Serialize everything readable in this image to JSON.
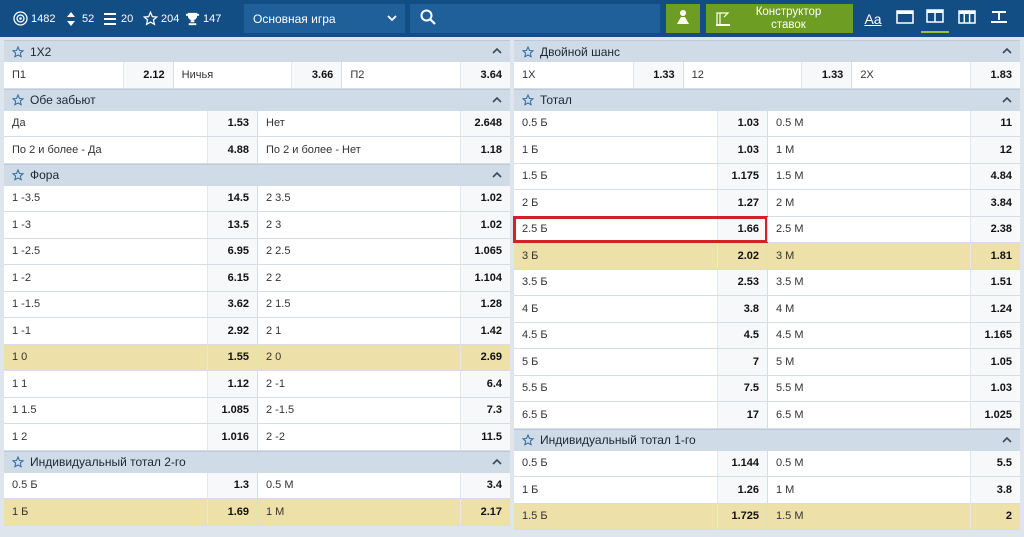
{
  "toolbar": {
    "stats": [
      {
        "icon": "live-icon",
        "value": "1482"
      },
      {
        "icon": "updown-icon",
        "value": "52"
      },
      {
        "icon": "bars-icon",
        "value": "20"
      },
      {
        "icon": "star-icon",
        "value": "204"
      },
      {
        "icon": "trophy-icon",
        "value": "147"
      }
    ],
    "game_select": "Основная игра",
    "builder_label_1": "Конструктор",
    "builder_label_2": "ставок",
    "font_size_label": "Aa",
    "colors": {
      "bar": "#124e84",
      "green": "#6d9e23",
      "highlight": "#ede0a9",
      "red": "#d61f26"
    }
  },
  "left": {
    "m1x2": {
      "title": "1Х2",
      "rows": [
        [
          {
            "l": "П1",
            "o": "2.12"
          },
          {
            "l": "Ничья",
            "o": "3.66"
          },
          {
            "l": "П2",
            "o": "3.64"
          }
        ]
      ]
    },
    "both": {
      "title": "Обе забьют",
      "rows": [
        [
          {
            "l": "Да",
            "o": "1.53"
          },
          {
            "l": "Нет",
            "o": "2.648"
          }
        ],
        [
          {
            "l": "По 2 и более - Да",
            "o": "4.88"
          },
          {
            "l": "По 2 и более - Нет",
            "o": "1.18"
          }
        ]
      ]
    },
    "fora": {
      "title": "Фора",
      "rows": [
        [
          {
            "l": "1 -3.5",
            "o": "14.5"
          },
          {
            "l": "2 3.5",
            "o": "1.02"
          }
        ],
        [
          {
            "l": "1 -3",
            "o": "13.5"
          },
          {
            "l": "2 3",
            "o": "1.02"
          }
        ],
        [
          {
            "l": "1 -2.5",
            "o": "6.95"
          },
          {
            "l": "2 2.5",
            "o": "1.065"
          }
        ],
        [
          {
            "l": "1 -2",
            "o": "6.15"
          },
          {
            "l": "2 2",
            "o": "1.104"
          }
        ],
        [
          {
            "l": "1 -1.5",
            "o": "3.62"
          },
          {
            "l": "2 1.5",
            "o": "1.28"
          }
        ],
        [
          {
            "l": "1 -1",
            "o": "2.92"
          },
          {
            "l": "2 1",
            "o": "1.42"
          }
        ],
        [
          {
            "l": "1 0",
            "o": "1.55"
          },
          {
            "l": "2 0",
            "o": "2.69"
          }
        ],
        [
          {
            "l": "1 1",
            "o": "1.12"
          },
          {
            "l": "2 -1",
            "o": "6.4"
          }
        ],
        [
          {
            "l": "1 1.5",
            "o": "1.085"
          },
          {
            "l": "2 -1.5",
            "o": "7.3"
          }
        ],
        [
          {
            "l": "1 2",
            "o": "1.016"
          },
          {
            "l": "2 -2",
            "o": "11.5"
          }
        ]
      ]
    },
    "ind2": {
      "title": "Индивидуальный тотал 2-го",
      "rows": [
        [
          {
            "l": "0.5 Б",
            "o": "1.3"
          },
          {
            "l": "0.5 М",
            "o": "3.4"
          }
        ],
        [
          {
            "l": "1 Б",
            "o": "1.69"
          },
          {
            "l": "1 М",
            "o": "2.17"
          }
        ]
      ]
    }
  },
  "right": {
    "double": {
      "title": "Двойной шанс",
      "rows": [
        [
          {
            "l": "1Х",
            "o": "1.33"
          },
          {
            "l": "12",
            "o": "1.33"
          },
          {
            "l": "2Х",
            "o": "1.83"
          }
        ]
      ]
    },
    "total": {
      "title": "Тотал",
      "rows": [
        [
          {
            "l": "0.5 Б",
            "o": "1.03"
          },
          {
            "l": "0.5 М",
            "o": "11"
          }
        ],
        [
          {
            "l": "1 Б",
            "o": "1.03"
          },
          {
            "l": "1 М",
            "o": "12"
          }
        ],
        [
          {
            "l": "1.5 Б",
            "o": "1.175"
          },
          {
            "l": "1.5 М",
            "o": "4.84"
          }
        ],
        [
          {
            "l": "2 Б",
            "o": "1.27"
          },
          {
            "l": "2 М",
            "o": "3.84"
          }
        ],
        [
          {
            "l": "2.5 Б",
            "o": "1.66"
          },
          {
            "l": "2.5 М",
            "o": "2.38"
          }
        ],
        [
          {
            "l": "3 Б",
            "o": "2.02"
          },
          {
            "l": "3 М",
            "o": "1.81"
          }
        ],
        [
          {
            "l": "3.5 Б",
            "o": "2.53"
          },
          {
            "l": "3.5 М",
            "o": "1.51"
          }
        ],
        [
          {
            "l": "4 Б",
            "o": "3.8"
          },
          {
            "l": "4 М",
            "o": "1.24"
          }
        ],
        [
          {
            "l": "4.5 Б",
            "o": "4.5"
          },
          {
            "l": "4.5 М",
            "o": "1.165"
          }
        ],
        [
          {
            "l": "5 Б",
            "o": "7"
          },
          {
            "l": "5 М",
            "o": "1.05"
          }
        ],
        [
          {
            "l": "5.5 Б",
            "o": "7.5"
          },
          {
            "l": "5.5 М",
            "o": "1.03"
          }
        ],
        [
          {
            "l": "6.5 Б",
            "o": "17"
          },
          {
            "l": "6.5 М",
            "o": "1.025"
          }
        ]
      ]
    },
    "ind1": {
      "title": "Индивидуальный тотал 1-го",
      "rows": [
        [
          {
            "l": "0.5 Б",
            "o": "1.144"
          },
          {
            "l": "0.5 М",
            "o": "5.5"
          }
        ],
        [
          {
            "l": "1 Б",
            "o": "1.26"
          },
          {
            "l": "1 М",
            "o": "3.8"
          }
        ],
        [
          {
            "l": "1.5 Б",
            "o": "1.725"
          },
          {
            "l": "1.5 М",
            "o": "2"
          }
        ]
      ]
    }
  }
}
